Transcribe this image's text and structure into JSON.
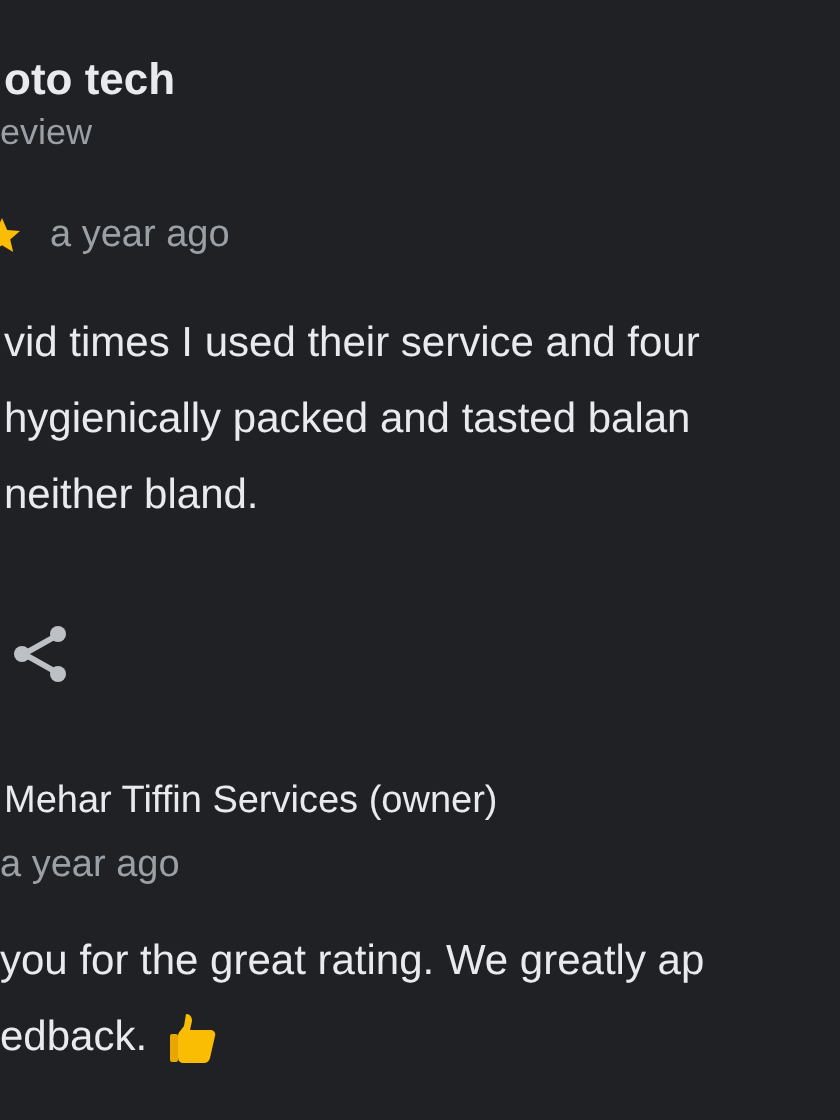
{
  "review": {
    "author": "oto tech",
    "author_meta": "eview",
    "time": "a year ago",
    "body_lines": [
      "vid times I used their service and four",
      "hygienically packed and tasted balan",
      "neither bland."
    ]
  },
  "owner_reply": {
    "author": "Mehar Tiffin Services (owner)",
    "time": "a year ago",
    "body_lines": [
      "you for the great rating. We greatly ap",
      "edback."
    ]
  }
}
